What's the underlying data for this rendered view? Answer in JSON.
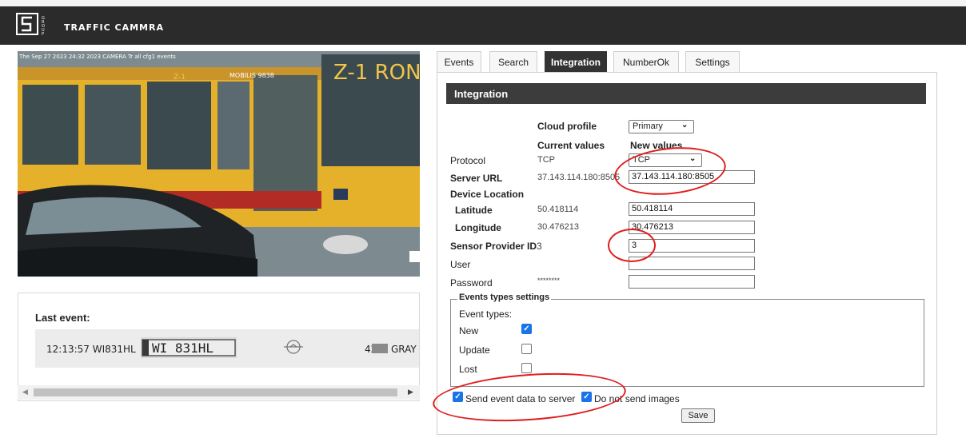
{
  "app": {
    "title": "TRAFFIC CAMMRA",
    "logo_letters": "GROUP"
  },
  "camera": {
    "overlay_text": "The Sep 27 2023 24:32 2023 CAMERA Tr all cfg1 events"
  },
  "last_event": {
    "heading": "Last event:",
    "time_plate": "12:13:57 WI831HL",
    "plate_image_text": "WI 831HL",
    "number": "42",
    "color_name": "GRAY",
    "color_swatch": "#8a8a8a"
  },
  "tabs": [
    {
      "label": "Events"
    },
    {
      "label": "Search"
    },
    {
      "label": "Integration"
    },
    {
      "label": "NumberOk"
    },
    {
      "label": "Settings"
    }
  ],
  "integration": {
    "section_title": "Integration",
    "cloud_profile_label": "Cloud profile",
    "cloud_profile_value": "Primary",
    "current_values_header": "Current values",
    "new_values_header": "New values",
    "protocol": {
      "label": "Protocol",
      "current": "TCP",
      "new": "TCP"
    },
    "server_url": {
      "label": "Server URL",
      "current": "37.143.114.180:8505",
      "new": "37.143.114.180:8505"
    },
    "device_location_label": "Device Location",
    "latitude": {
      "label": "Latitude",
      "current": "50.418114",
      "new": "50.418114"
    },
    "longitude": {
      "label": "Longitude",
      "current": "30.476213",
      "new": "30.476213"
    },
    "sensor_provider_id": {
      "label": "Sensor Provider ID",
      "current": "3",
      "new": "3"
    },
    "user": {
      "label": "User",
      "current": "",
      "new": ""
    },
    "password": {
      "label": "Password",
      "current": "********",
      "new": ""
    },
    "event_types_settings": {
      "legend": "Events types settings",
      "event_types_label": "Event types:",
      "items": [
        {
          "label": "New",
          "checked": true
        },
        {
          "label": "Update",
          "checked": false
        },
        {
          "label": "Lost",
          "checked": false
        }
      ]
    },
    "send_event_data_label": "Send event data to server",
    "send_event_data_checked": true,
    "do_not_send_images_label": "Do not send images",
    "do_not_send_images_checked": true,
    "save_label": "Save"
  },
  "colors": {
    "header_bg": "#2b2b2b",
    "section_bg": "#3c3c3c",
    "annotation_red": "#e01d1d",
    "checkbox_blue": "#1a73e8"
  }
}
